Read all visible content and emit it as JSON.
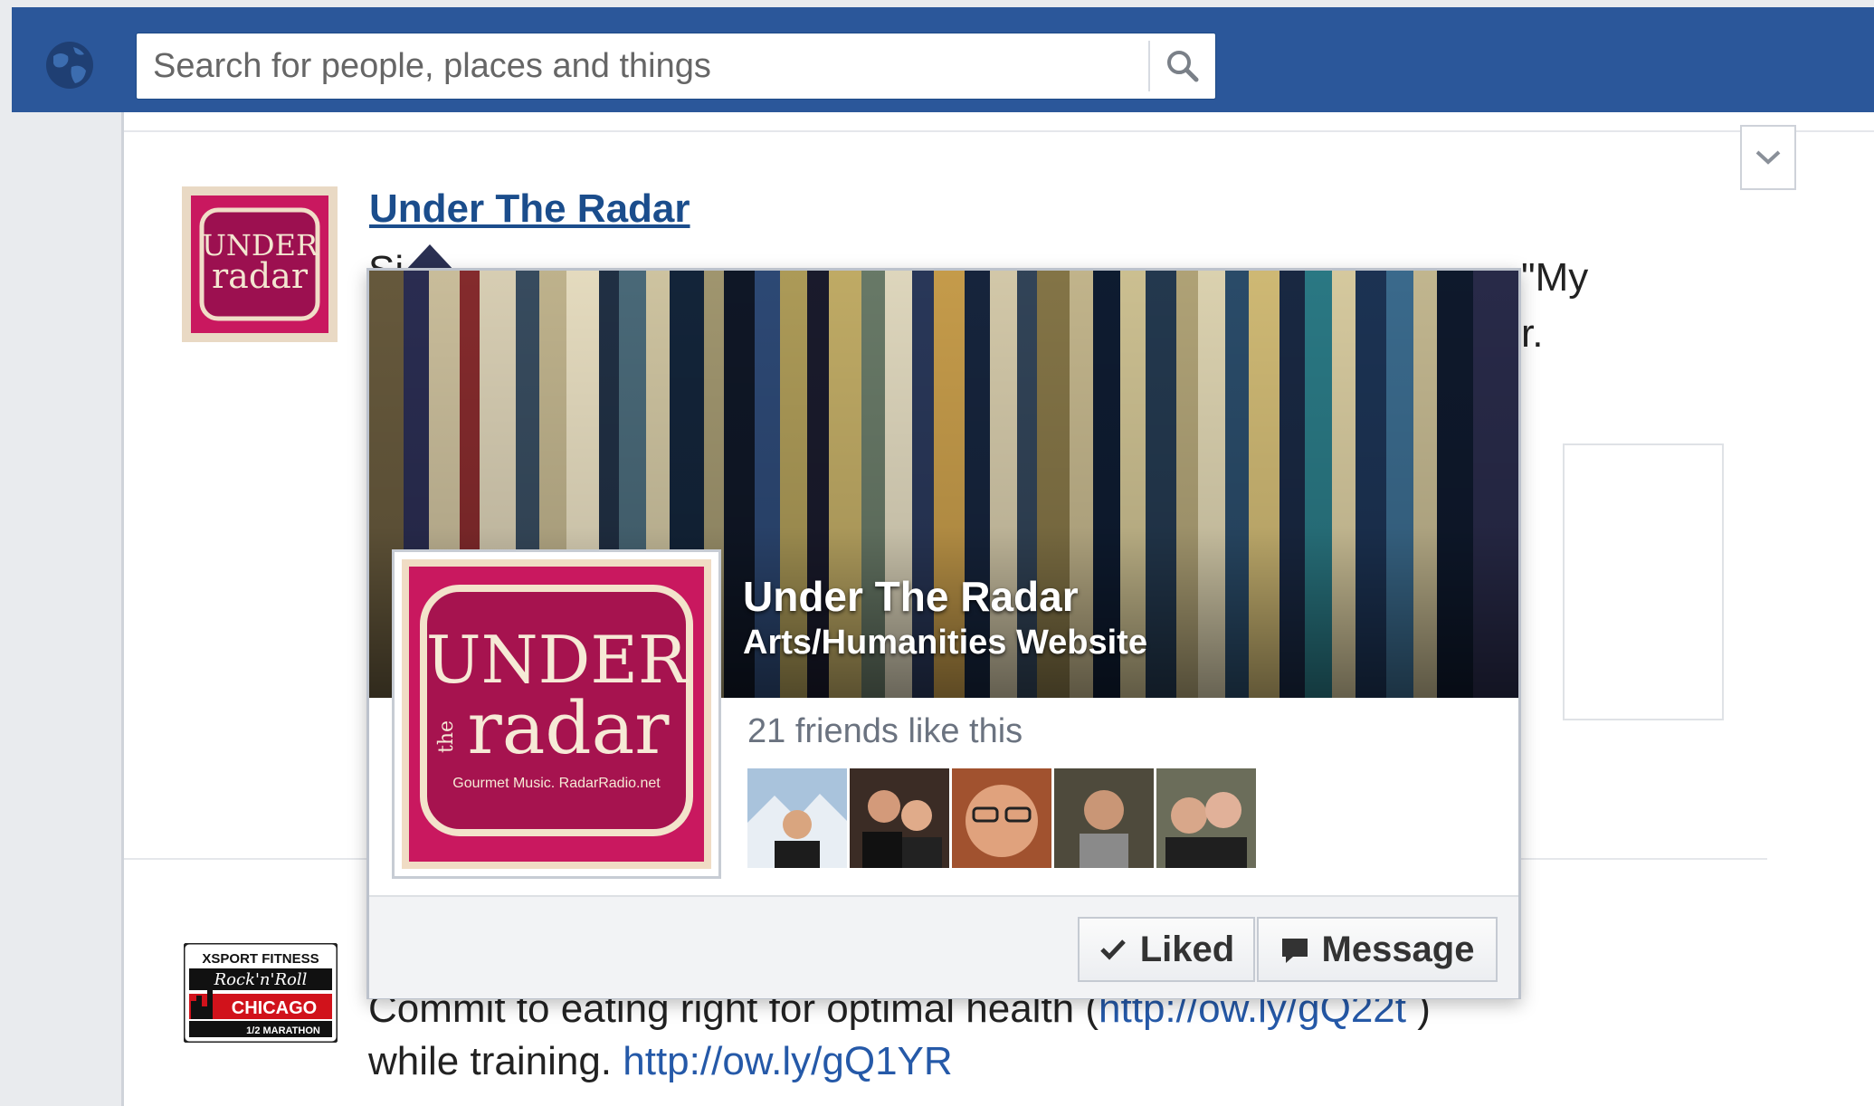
{
  "search": {
    "placeholder": "Search for people, places and things"
  },
  "post1": {
    "title": "Under The Radar",
    "text_fragment_1": "Si...",
    "text_fragment_2": "\"My",
    "text_fragment_3": "r."
  },
  "hovercard": {
    "name": "Under The Radar",
    "category": "Arts/Humanities Website",
    "friends_text": "21 friends like this",
    "profile_logo_line1": "UNDER",
    "profile_logo_line2": "the",
    "profile_logo_line3": "radar",
    "profile_logo_tagline": "Gourmet Music. RadarRadio.net",
    "liked_label": "Liked",
    "message_label": "Message"
  },
  "post2": {
    "line1_text": "Commit to eating right for optimal health (",
    "line1_link": "http://ow.ly/gQ22t",
    "line1_suffix": " )",
    "line2_text": "while training. ",
    "line2_link": "http://ow.ly/gQ1YR",
    "thumb_line1": "XSPORT FITNESS",
    "thumb_line2": "Rock'n'Roll",
    "thumb_line3": "CHICAGO",
    "thumb_line4": "1/2 MARATHON"
  },
  "colors": {
    "topbar": "#2b579a",
    "link": "#2559a8",
    "title_link": "#1b4d8c",
    "logo_pink": "#c9185f"
  },
  "icons": [
    "globe-icon",
    "search-icon",
    "chevron-down-icon",
    "checkmark-icon",
    "message-icon"
  ]
}
